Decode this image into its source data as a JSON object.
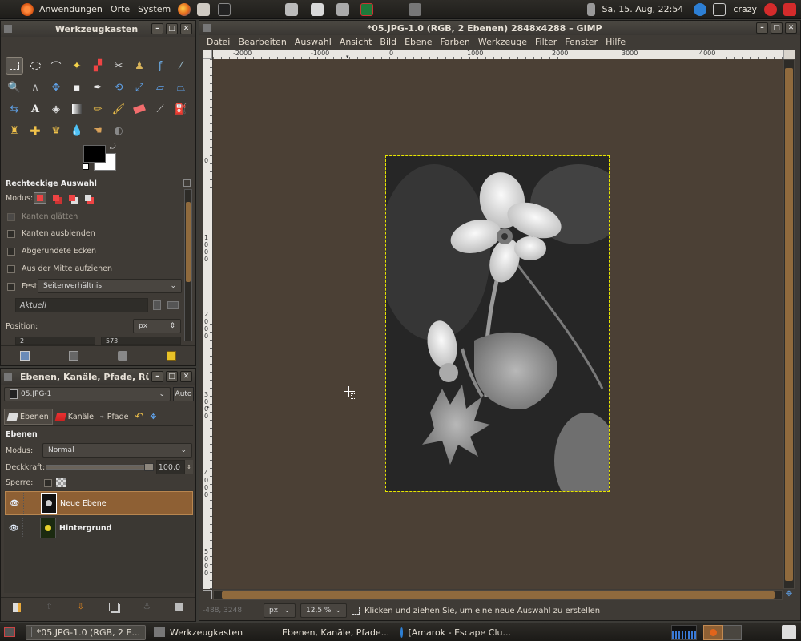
{
  "top_panel": {
    "menus": [
      "Anwendungen",
      "Orte",
      "System"
    ],
    "clock": "Sa, 15. Aug, 22:54",
    "user": "crazy"
  },
  "toolbox": {
    "title": "Werkzeugkasten",
    "options_title": "Rechteckige Auswahl",
    "mode_label": "Modus:",
    "options": {
      "antialias": "Kanten glätten",
      "feather": "Kanten ausblenden",
      "rounded": "Abgerundete Ecken",
      "from_center": "Aus der Mitte aufziehen",
      "fixed": "Fest",
      "fixed_value": "Seitenverhältnis",
      "current": "Aktuell",
      "position_label": "Position:",
      "unit": "px",
      "pos_x": "2",
      "pos_y": "573"
    }
  },
  "layers_dialog": {
    "title": "Ebenen, Kanäle, Pfade, Rü",
    "image_select": "05.JPG-1",
    "auto_button": "Auto",
    "tabs": [
      "Ebenen",
      "Kanäle",
      "Pfade"
    ],
    "section_title": "Ebenen",
    "mode_label": "Modus:",
    "mode_value": "Normal",
    "opacity_label": "Deckkraft:",
    "opacity_value": "100,0",
    "opacity": 1.0,
    "lock_label": "Sperre:",
    "layers": [
      {
        "name": "Neue Ebene",
        "selected": true
      },
      {
        "name": "Hintergrund",
        "selected": false
      }
    ]
  },
  "image_window": {
    "title": "*05.JPG-1.0 (RGB, 2 Ebenen) 2848x4288 – GIMP",
    "menu": [
      "Datei",
      "Bearbeiten",
      "Auswahl",
      "Ansicht",
      "Bild",
      "Ebene",
      "Farben",
      "Werkzeuge",
      "Filter",
      "Fenster",
      "Hilfe"
    ],
    "ruler_h": [
      "-2000",
      "-1000",
      "0",
      "1000",
      "2000",
      "3000",
      "4000",
      "5"
    ],
    "ruler_v": [
      "0",
      "1000",
      "2000",
      "3000",
      "4000",
      "5000"
    ],
    "status": {
      "coords": "-488, 3248",
      "unit": "px",
      "zoom": "12,5 %",
      "message": "Klicken und ziehen Sie, um eine neue Auswahl zu erstellen"
    }
  },
  "taskbar": [
    {
      "label": "*05.JPG-1.0 (RGB, 2 E...",
      "active": true
    },
    {
      "label": "Werkzeugkasten",
      "active": false
    },
    {
      "label": "Ebenen, Kanäle, Pfade...",
      "active": false
    },
    {
      "label": "[Amarok - Escape Clu...",
      "active": false
    }
  ],
  "colors": {
    "accent_selected_row": "#8e6034",
    "canvas_bg": "#4b4035",
    "selection_dash": "#e6e600"
  }
}
